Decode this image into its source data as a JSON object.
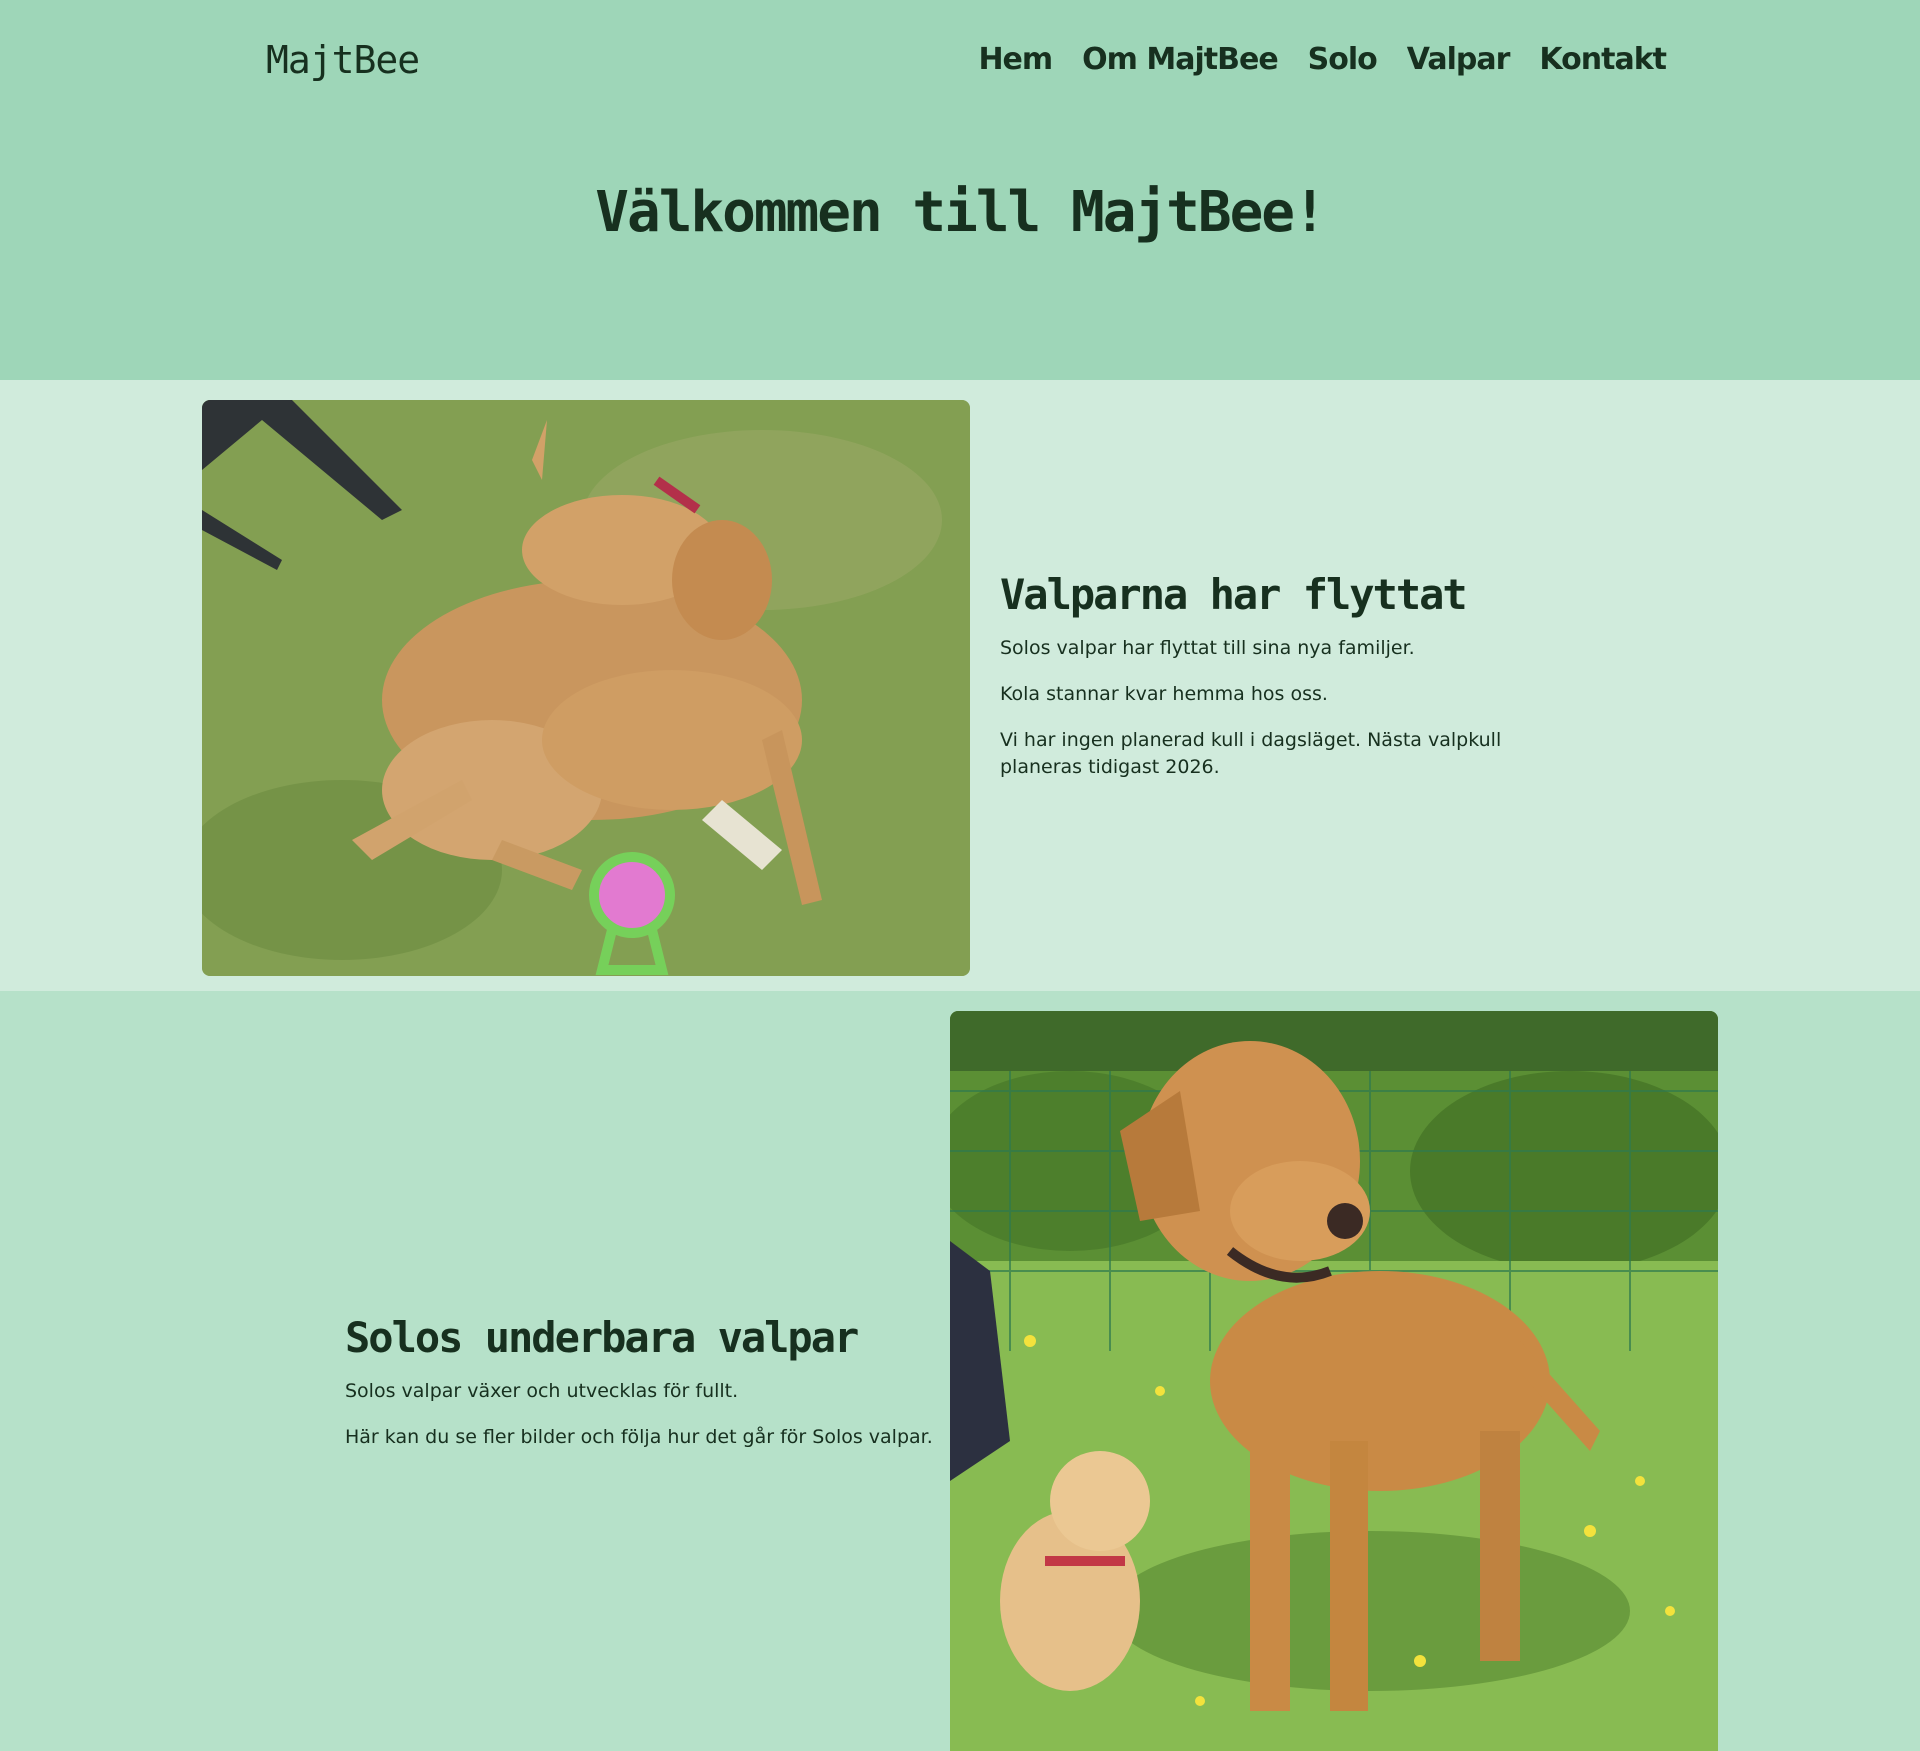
{
  "header": {
    "logo": "MajtBee",
    "nav": [
      "Hem",
      "Om MajtBee",
      "Solo",
      "Valpar",
      "Kontakt"
    ],
    "hero_title": "Välkommen till MajtBee!"
  },
  "section1": {
    "title": "Valparna har flyttat",
    "paragraphs": [
      "Solos valpar har flyttat till sina nya familjer.",
      "Kola stannar kvar hemma hos oss.",
      "Vi har ingen planerad kull i dagsläget. Nästa valpkull planeras tidigast 2026."
    ]
  },
  "section2": {
    "title": "Solos underbara valpar",
    "paragraphs": [
      "Solos valpar växer och utvecklas för fullt.",
      "Här kan du se fler bilder och följa hur det går för Solos valpar."
    ]
  },
  "colors": {
    "header_bg": "#9ed6b8",
    "section1_bg": "#d0ebdc",
    "section2_bg": "#b6e1c9",
    "text": "#17301f"
  }
}
